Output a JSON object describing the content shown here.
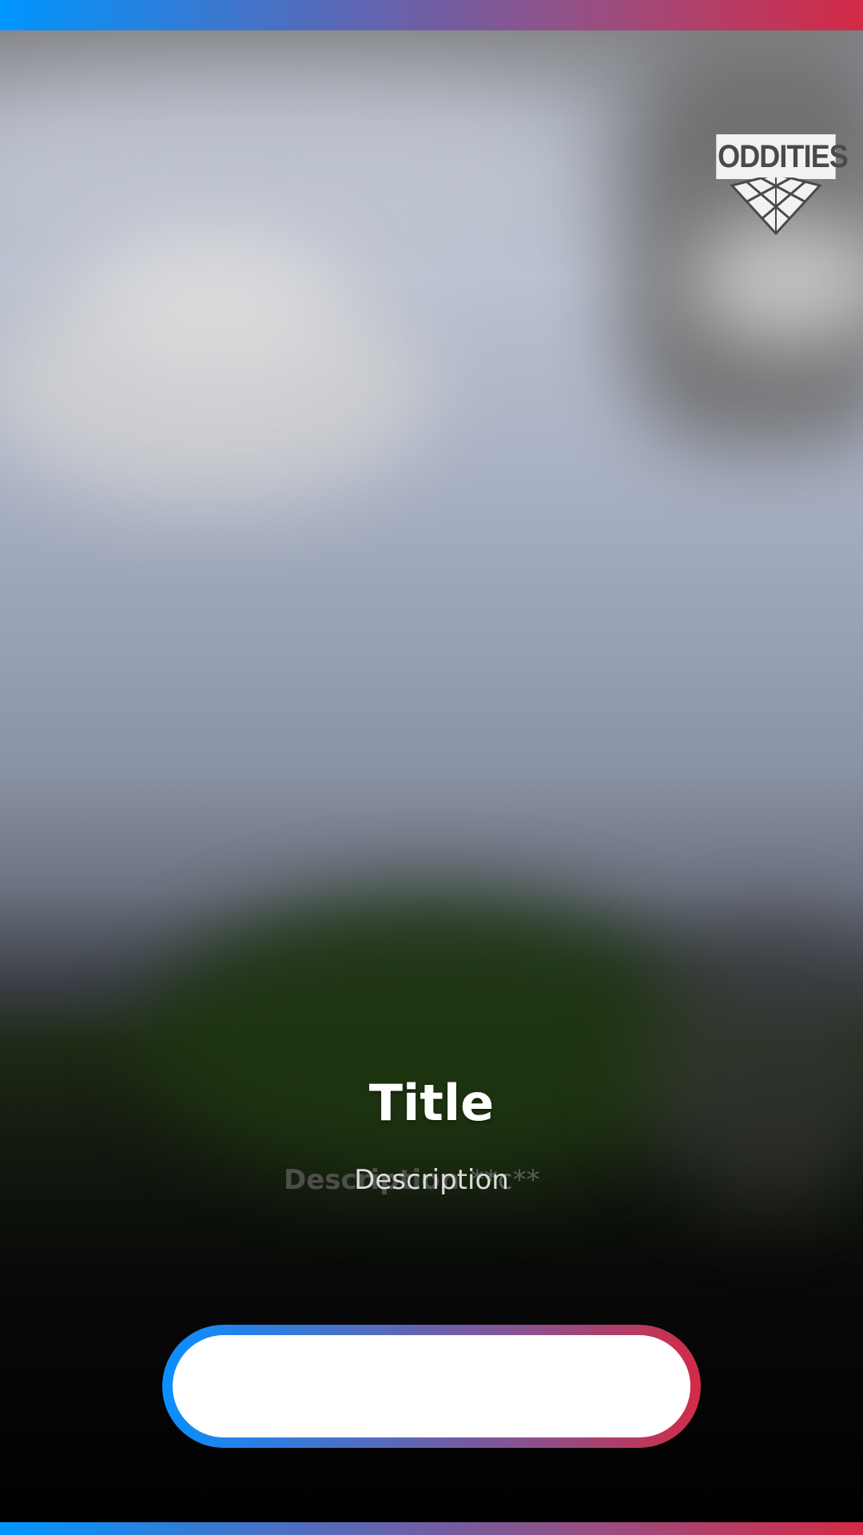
{
  "brand": {
    "logo_text": "ODDITIES",
    "logo_icon": "grid-diamond-icon"
  },
  "content": {
    "title": "Title",
    "description": "Description",
    "description_ghost": "Description",
    "description_ghost_suffix": "**c**"
  },
  "action": {
    "button_label": ""
  },
  "colors": {
    "accent_start": "#0096ff",
    "accent_end": "#d42a46"
  }
}
